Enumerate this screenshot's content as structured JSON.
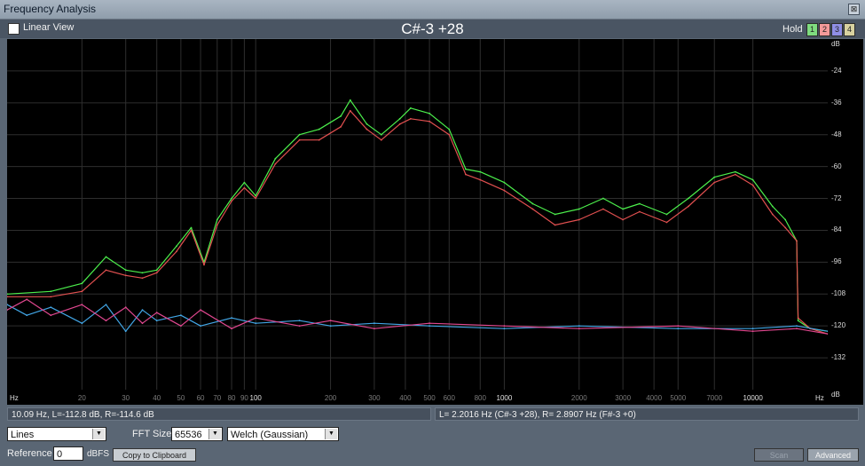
{
  "window": {
    "title": "Frequency Analysis",
    "close_glyph": "⊠"
  },
  "header": {
    "linear_view_label": "Linear View",
    "linear_view_checked": false,
    "note_readout": "C#-3 +28",
    "hold_label": "Hold",
    "hold_buttons": [
      {
        "label": "1",
        "color": "#7fdc7f"
      },
      {
        "label": "2",
        "color": "#f39a9a"
      },
      {
        "label": "3",
        "color": "#8f8fe6"
      },
      {
        "label": "4",
        "color": "#d8d2a0"
      }
    ]
  },
  "chart_data": {
    "type": "line",
    "x_scale": "log",
    "xlim": [
      10,
      20000
    ],
    "ylim": [
      -144,
      -12
    ],
    "y_unit_label": "dB",
    "x_unit_label": "Hz",
    "x_ticks": [
      {
        "v": 20,
        "l": "20"
      },
      {
        "v": 30,
        "l": "30"
      },
      {
        "v": 40,
        "l": "40"
      },
      {
        "v": 50,
        "l": "50"
      },
      {
        "v": 60,
        "l": "60"
      },
      {
        "v": 70,
        "l": "70"
      },
      {
        "v": 80,
        "l": "80"
      },
      {
        "v": 90,
        "l": "90"
      },
      {
        "v": 100,
        "l": "100"
      },
      {
        "v": 200,
        "l": "200"
      },
      {
        "v": 300,
        "l": "300"
      },
      {
        "v": 400,
        "l": "400"
      },
      {
        "v": 500,
        "l": "500"
      },
      {
        "v": 600,
        "l": "600"
      },
      {
        "v": 800,
        "l": "800"
      },
      {
        "v": 1000,
        "l": "1000"
      },
      {
        "v": 2000,
        "l": "2000"
      },
      {
        "v": 3000,
        "l": "3000"
      },
      {
        "v": 4000,
        "l": "4000"
      },
      {
        "v": 5000,
        "l": "5000"
      },
      {
        "v": 7000,
        "l": "7000"
      },
      {
        "v": 10000,
        "l": "10000"
      }
    ],
    "y_ticks": [
      -24,
      -36,
      -48,
      -60,
      -72,
      -84,
      -96,
      -108,
      -120,
      -132
    ],
    "series": [
      {
        "color": "#4cf04c",
        "points": [
          [
            10,
            -108
          ],
          [
            15,
            -107
          ],
          [
            20,
            -104
          ],
          [
            25,
            -94
          ],
          [
            30,
            -99
          ],
          [
            35,
            -100
          ],
          [
            40,
            -99
          ],
          [
            48,
            -90
          ],
          [
            55,
            -83
          ],
          [
            62,
            -96
          ],
          [
            70,
            -80
          ],
          [
            80,
            -72
          ],
          [
            90,
            -66
          ],
          [
            100,
            -71
          ],
          [
            120,
            -57
          ],
          [
            150,
            -48
          ],
          [
            180,
            -46
          ],
          [
            220,
            -41
          ],
          [
            240,
            -35
          ],
          [
            280,
            -44
          ],
          [
            320,
            -48
          ],
          [
            380,
            -42
          ],
          [
            420,
            -38
          ],
          [
            500,
            -40
          ],
          [
            600,
            -46
          ],
          [
            700,
            -61
          ],
          [
            800,
            -62
          ],
          [
            1000,
            -66
          ],
          [
            1300,
            -74
          ],
          [
            1600,
            -78
          ],
          [
            2000,
            -76
          ],
          [
            2500,
            -72
          ],
          [
            3000,
            -76
          ],
          [
            3500,
            -74
          ],
          [
            4500,
            -78
          ],
          [
            5500,
            -72
          ],
          [
            7000,
            -64
          ],
          [
            8500,
            -62
          ],
          [
            10000,
            -65
          ],
          [
            12000,
            -75
          ],
          [
            13500,
            -80
          ],
          [
            15000,
            -88
          ],
          [
            15200,
            -118
          ],
          [
            17000,
            -121
          ],
          [
            20000,
            -122
          ]
        ]
      },
      {
        "color": "#e25050",
        "points": [
          [
            10,
            -109
          ],
          [
            15,
            -109
          ],
          [
            20,
            -107
          ],
          [
            25,
            -99
          ],
          [
            30,
            -101
          ],
          [
            35,
            -102
          ],
          [
            40,
            -100
          ],
          [
            48,
            -92
          ],
          [
            55,
            -84
          ],
          [
            62,
            -97
          ],
          [
            70,
            -82
          ],
          [
            80,
            -73
          ],
          [
            90,
            -68
          ],
          [
            100,
            -72
          ],
          [
            120,
            -59
          ],
          [
            150,
            -50
          ],
          [
            180,
            -50
          ],
          [
            220,
            -45
          ],
          [
            240,
            -39
          ],
          [
            280,
            -46
          ],
          [
            320,
            -50
          ],
          [
            380,
            -44
          ],
          [
            420,
            -42
          ],
          [
            500,
            -43
          ],
          [
            600,
            -48
          ],
          [
            700,
            -63
          ],
          [
            800,
            -65
          ],
          [
            1000,
            -69
          ],
          [
            1300,
            -76
          ],
          [
            1600,
            -82
          ],
          [
            2000,
            -80
          ],
          [
            2500,
            -76
          ],
          [
            3000,
            -80
          ],
          [
            3500,
            -77
          ],
          [
            4500,
            -81
          ],
          [
            5500,
            -75
          ],
          [
            7000,
            -66
          ],
          [
            8500,
            -63
          ],
          [
            10000,
            -67
          ],
          [
            12000,
            -78
          ],
          [
            13500,
            -83
          ],
          [
            15000,
            -88
          ],
          [
            15200,
            -117
          ],
          [
            17000,
            -121
          ],
          [
            20000,
            -123
          ]
        ]
      },
      {
        "color": "#42a6e6",
        "points": [
          [
            10,
            -112
          ],
          [
            12,
            -116
          ],
          [
            15,
            -113
          ],
          [
            20,
            -119
          ],
          [
            25,
            -112
          ],
          [
            30,
            -122
          ],
          [
            35,
            -114
          ],
          [
            40,
            -118
          ],
          [
            50,
            -116
          ],
          [
            60,
            -120
          ],
          [
            80,
            -117
          ],
          [
            100,
            -119
          ],
          [
            150,
            -118
          ],
          [
            200,
            -120
          ],
          [
            300,
            -119
          ],
          [
            500,
            -120
          ],
          [
            1000,
            -121
          ],
          [
            2000,
            -120
          ],
          [
            5000,
            -121
          ],
          [
            10000,
            -121
          ],
          [
            15000,
            -120
          ],
          [
            20000,
            -122
          ]
        ]
      },
      {
        "color": "#e0478f",
        "points": [
          [
            10,
            -114
          ],
          [
            12,
            -110
          ],
          [
            15,
            -116
          ],
          [
            20,
            -112
          ],
          [
            25,
            -118
          ],
          [
            30,
            -113
          ],
          [
            35,
            -119
          ],
          [
            40,
            -115
          ],
          [
            50,
            -120
          ],
          [
            60,
            -114
          ],
          [
            80,
            -121
          ],
          [
            100,
            -117
          ],
          [
            150,
            -120
          ],
          [
            200,
            -118
          ],
          [
            300,
            -121
          ],
          [
            500,
            -119
          ],
          [
            1000,
            -120
          ],
          [
            2000,
            -121
          ],
          [
            5000,
            -120
          ],
          [
            10000,
            -122
          ],
          [
            15000,
            -121
          ],
          [
            20000,
            -123
          ]
        ]
      }
    ]
  },
  "status": {
    "left": "10.09 Hz, L=-112.8 dB, R=-114.6 dB",
    "right": "L= 2.2016 Hz (C#-3 +28), R= 2.8907 Hz (F#-3 +0)"
  },
  "controls": {
    "display_mode": "Lines",
    "fft_size_label": "FFT Size",
    "fft_size": "65536",
    "window_func": "Welch (Gaussian)",
    "reference_label": "Reference",
    "reference_value": "0",
    "dbfs_label": "dBFS",
    "copy_button": "Copy to Clipboard",
    "scan_button": "Scan",
    "advanced_button": "Advanced",
    "dropdown_arrow": "▼"
  }
}
